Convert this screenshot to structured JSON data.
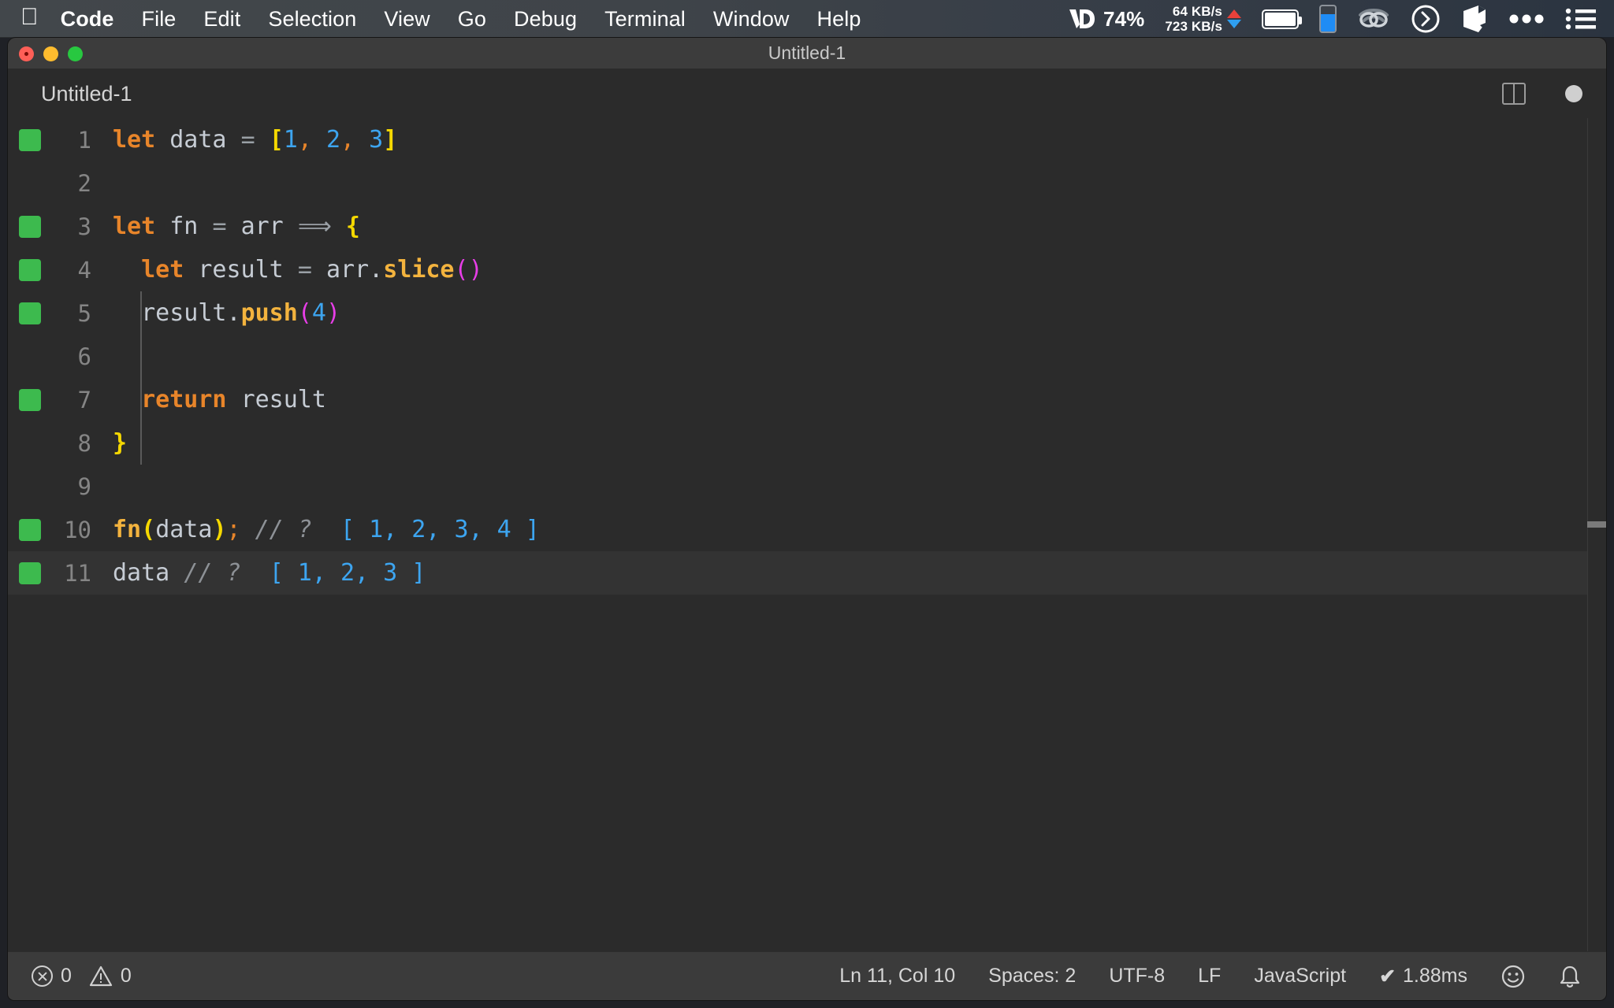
{
  "menubar": {
    "apple_glyph": "",
    "items": [
      {
        "label": "Code",
        "bold": true
      },
      {
        "label": "File",
        "bold": false
      },
      {
        "label": "Edit",
        "bold": false
      },
      {
        "label": "Selection",
        "bold": false
      },
      {
        "label": "View",
        "bold": false
      },
      {
        "label": "Go",
        "bold": false
      },
      {
        "label": "Debug",
        "bold": false
      },
      {
        "label": "Terminal",
        "bold": false
      },
      {
        "label": "Window",
        "bold": false
      },
      {
        "label": "Help",
        "bold": false
      }
    ],
    "tray": {
      "vd_percent": "74%",
      "net_up": "64 KB/s",
      "net_down": "723 KB/s",
      "icons": [
        "vd-logo-icon",
        "network-arrows-icon",
        "battery-icon",
        "blue-level-icon",
        "wifi-eye-icon",
        "clock-icon",
        "cube-icon",
        "ellipsis-icon",
        "list-icon"
      ]
    }
  },
  "window": {
    "title": "Untitled-1",
    "traffic_lights": [
      "close",
      "minimize",
      "zoom"
    ]
  },
  "tabbar": {
    "tab_label": "Untitled-1",
    "split_icon": "split-editor-icon",
    "dirty_icon": "unsaved-dot-icon"
  },
  "editor": {
    "language": "JavaScript",
    "lines": [
      {
        "num": "1",
        "marked": true,
        "active": false,
        "tokens": [
          {
            "t": "let",
            "c": "t-kw"
          },
          {
            "t": " ",
            "c": "t-var"
          },
          {
            "t": "data",
            "c": "t-var"
          },
          {
            "t": " ",
            "c": "t-var"
          },
          {
            "t": "=",
            "c": "t-op"
          },
          {
            "t": " ",
            "c": "t-var"
          },
          {
            "t": "[",
            "c": "t-brk"
          },
          {
            "t": "1",
            "c": "t-num"
          },
          {
            "t": ",",
            "c": "t-punc"
          },
          {
            "t": " ",
            "c": "t-var"
          },
          {
            "t": "2",
            "c": "t-num"
          },
          {
            "t": ",",
            "c": "t-punc"
          },
          {
            "t": " ",
            "c": "t-var"
          },
          {
            "t": "3",
            "c": "t-num"
          },
          {
            "t": "]",
            "c": "t-brk"
          }
        ]
      },
      {
        "num": "2",
        "marked": false,
        "active": false,
        "tokens": []
      },
      {
        "num": "3",
        "marked": true,
        "active": false,
        "tokens": [
          {
            "t": "let",
            "c": "t-kw"
          },
          {
            "t": " ",
            "c": "t-var"
          },
          {
            "t": "fn",
            "c": "t-var"
          },
          {
            "t": " ",
            "c": "t-var"
          },
          {
            "t": "=",
            "c": "t-op"
          },
          {
            "t": " ",
            "c": "t-var"
          },
          {
            "t": "arr",
            "c": "t-var"
          },
          {
            "t": " ",
            "c": "t-var"
          },
          {
            "t": "⟹",
            "c": "t-op"
          },
          {
            "t": " ",
            "c": "t-var"
          },
          {
            "t": "{",
            "c": "t-brk"
          }
        ]
      },
      {
        "num": "4",
        "marked": true,
        "active": false,
        "tokens": [
          {
            "t": "  ",
            "c": "t-var"
          },
          {
            "t": "let",
            "c": "t-kw"
          },
          {
            "t": " ",
            "c": "t-var"
          },
          {
            "t": "result",
            "c": "t-var"
          },
          {
            "t": " ",
            "c": "t-var"
          },
          {
            "t": "=",
            "c": "t-op"
          },
          {
            "t": " ",
            "c": "t-var"
          },
          {
            "t": "arr",
            "c": "t-var"
          },
          {
            "t": ".",
            "c": "t-var"
          },
          {
            "t": "slice",
            "c": "t-fn"
          },
          {
            "t": "(",
            "c": "t-paren"
          },
          {
            "t": ")",
            "c": "t-paren"
          }
        ]
      },
      {
        "num": "5",
        "marked": true,
        "active": false,
        "tokens": [
          {
            "t": "  ",
            "c": "t-var"
          },
          {
            "t": "result",
            "c": "t-var"
          },
          {
            "t": ".",
            "c": "t-var"
          },
          {
            "t": "push",
            "c": "t-fn"
          },
          {
            "t": "(",
            "c": "t-paren"
          },
          {
            "t": "4",
            "c": "t-num"
          },
          {
            "t": ")",
            "c": "t-paren"
          }
        ]
      },
      {
        "num": "6",
        "marked": false,
        "active": false,
        "tokens": []
      },
      {
        "num": "7",
        "marked": true,
        "active": false,
        "tokens": [
          {
            "t": "  ",
            "c": "t-var"
          },
          {
            "t": "return",
            "c": "t-kw"
          },
          {
            "t": " ",
            "c": "t-var"
          },
          {
            "t": "result",
            "c": "t-var"
          }
        ]
      },
      {
        "num": "8",
        "marked": false,
        "active": false,
        "tokens": [
          {
            "t": "}",
            "c": "t-brk"
          }
        ]
      },
      {
        "num": "9",
        "marked": false,
        "active": false,
        "tokens": []
      },
      {
        "num": "10",
        "marked": true,
        "active": false,
        "tokens": [
          {
            "t": "fn",
            "c": "t-fn"
          },
          {
            "t": "(",
            "c": "t-brk"
          },
          {
            "t": "data",
            "c": "t-var"
          },
          {
            "t": ")",
            "c": "t-brk"
          },
          {
            "t": ";",
            "c": "t-punc"
          },
          {
            "t": " ",
            "c": "t-var"
          },
          {
            "t": "// ?",
            "c": "t-cmt"
          },
          {
            "t": "  ",
            "c": "t-var"
          },
          {
            "t": "[ 1, 2, 3, 4 ]",
            "c": "t-val"
          }
        ]
      },
      {
        "num": "11",
        "marked": true,
        "active": true,
        "tokens": [
          {
            "t": "data",
            "c": "t-var"
          },
          {
            "t": " ",
            "c": "t-var"
          },
          {
            "t": "// ?",
            "c": "t-cmt"
          },
          {
            "t": "  ",
            "c": "t-var"
          },
          {
            "t": "[ 1, 2, 3 ]",
            "c": "t-val"
          }
        ]
      }
    ]
  },
  "statusbar": {
    "errors": "0",
    "warnings": "0",
    "cursor": "Ln 11, Col 10",
    "indentation": "Spaces: 2",
    "encoding": "UTF-8",
    "eol": "LF",
    "language": "JavaScript",
    "runtime": "1.88ms",
    "check_glyph": "✔",
    "feedback_icon": "smiley-icon",
    "bell_icon": "bell-icon"
  },
  "colors": {
    "menubar_left": "#42474b",
    "menubar_right": "#2b3440",
    "editor_bg": "#2b2b2b",
    "active_line_bg": "#333333",
    "titlebar_bg": "#3c3c3c",
    "statusbar_bg": "#3b3b3b",
    "coverage_green": "#3dba4e",
    "keyword_orange": "#e8852a",
    "bracket_yellow": "#f5d800",
    "number_blue": "#3da5f0",
    "function_yellow": "#f3b33e",
    "paren_magenta": "#e83ee8",
    "comment_gray": "#8d9196"
  }
}
